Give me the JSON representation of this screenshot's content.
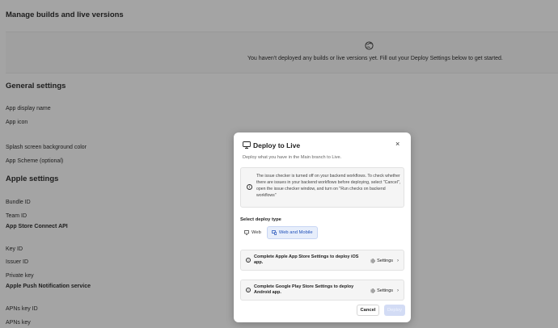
{
  "background": {
    "builds": {
      "heading": "Manage builds and live versions",
      "empty_text": "You haven't deployed any builds or live versions yet. Fill out your Deploy Settings below to get started.",
      "icon": "globe-icon"
    },
    "general": {
      "heading": "General settings",
      "fields": [
        "App display name",
        "App icon",
        "Splash screen background color",
        "App Scheme (optional)"
      ]
    },
    "apple": {
      "heading": "Apple settings",
      "fields": [
        "Bundle ID",
        "Team ID"
      ],
      "subheading": "App Store Connect API",
      "fields2": [
        "Key ID",
        "Issuer ID",
        "Private key"
      ],
      "subheading2": "Apple Push Notification service",
      "fields3": [
        "APNs key ID",
        "APNs key"
      ]
    }
  },
  "modal": {
    "title": "Deploy to Live",
    "title_icon": "monitor-icon",
    "close": "×",
    "subtitle": "Deploy what you have in the Main branch to Live.",
    "notice": "The issue checker is turned off on your backend workflows. To check whether there are issues in your backend workflows before deploying, select \"Cancel\", open the issue checker window, and turn on \"Run checks on backend workflows\"",
    "deploy_type_label": "Select deploy type",
    "deploy_types": [
      {
        "label": "Web",
        "icon": "monitor-icon",
        "active": false
      },
      {
        "label": "Web and Mobile",
        "icon": "devices-icon",
        "active": true
      }
    ],
    "cards": [
      {
        "text": "Complete Apple App Store Settings to deploy iOS app.",
        "button": "Settings"
      },
      {
        "text": "Complete Google Play Store Settings to deploy Android app.",
        "button": "Settings"
      }
    ],
    "cancel": "Cancel",
    "deploy": "Deploy",
    "colors": {
      "accent": "#1e4fb8",
      "deploy_disabled": "#d3dcf5"
    }
  }
}
